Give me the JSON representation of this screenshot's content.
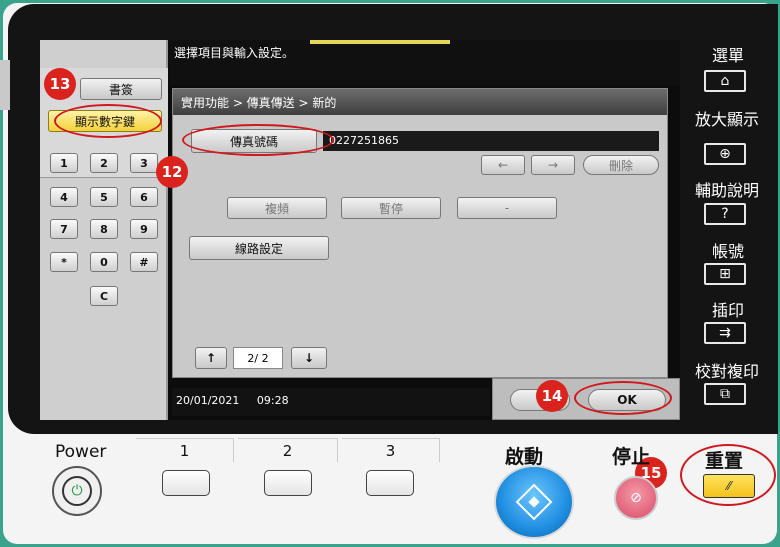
{
  "screen_header": {
    "instruction": "選擇項目與輸入設定。"
  },
  "left_panel": {
    "bookmark_label": "書簽",
    "show_keypad_label": "顯示數字鍵",
    "keys": [
      "1",
      "2",
      "3",
      "4",
      "5",
      "6",
      "7",
      "8",
      "9",
      "*",
      "0",
      "#"
    ],
    "clear_key": "C"
  },
  "dialog": {
    "breadcrumb": "實用功能 > 傳真傳送 > 新的",
    "fax_number_label": "傳真號碼",
    "fax_number_value": "0227251865",
    "back_arrow": "←",
    "forward_arrow": "→",
    "delete_label": "刪除",
    "copy_label": "複頻",
    "pause_label": "暫停",
    "dash_label": "-",
    "line_settings_label": "線路設定",
    "page_up": "↑",
    "page_indicator": "2/ 2",
    "page_down": "↓",
    "ok_label": "OK"
  },
  "status_bar": {
    "date": "20/01/2021",
    "time": "09:28"
  },
  "right_menu": [
    {
      "label": "選單",
      "icon": "home-icon",
      "glyph": "⌂"
    },
    {
      "label": "放大顯示",
      "icon": "zoom-icon",
      "glyph": "⊕"
    },
    {
      "label": "輔助說明",
      "icon": "help-icon",
      "glyph": "?"
    },
    {
      "label": "帳號",
      "icon": "account-icon",
      "glyph": "⊞"
    },
    {
      "label": "插印",
      "icon": "interrupt-icon",
      "glyph": "⇉"
    },
    {
      "label": "校對複印",
      "icon": "proof-copy-icon",
      "glyph": "⧉"
    }
  ],
  "callouts": [
    "13",
    "12",
    "14",
    "15"
  ],
  "hardware": {
    "power_label": "Power",
    "num_buttons": [
      "1",
      "2",
      "3"
    ],
    "start_label": "啟動",
    "stop_label": "停止",
    "reset_label": "重置"
  },
  "colors": {
    "accent_red": "#d9231c",
    "start_blue": "#1f8ee0",
    "reset_yellow": "#f4cc1c"
  }
}
